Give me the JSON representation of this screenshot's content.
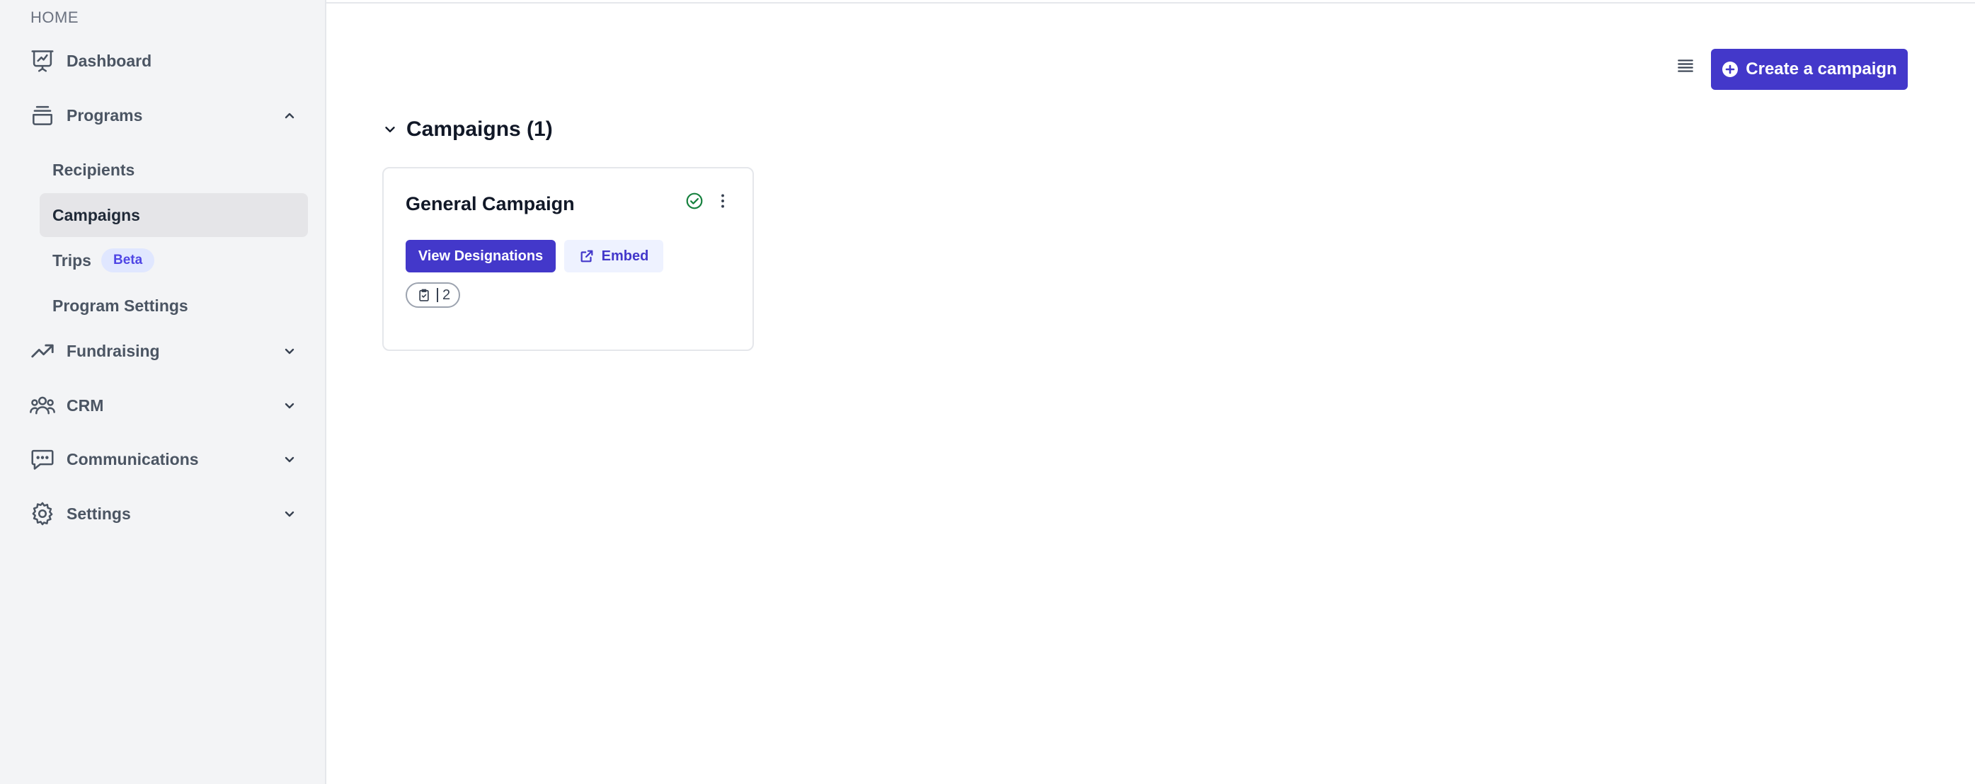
{
  "sidebar": {
    "section_label": "HOME",
    "items": [
      {
        "label": "Dashboard",
        "icon": "presentation-chart-icon"
      },
      {
        "label": "Programs",
        "icon": "inbox-stack-icon",
        "expanded": true
      },
      {
        "label": "Fundraising",
        "icon": "trending-up-icon",
        "expanded": false
      },
      {
        "label": "CRM",
        "icon": "user-group-icon",
        "expanded": false
      },
      {
        "label": "Communications",
        "icon": "chat-bubble-icon",
        "expanded": false
      },
      {
        "label": "Settings",
        "icon": "gear-icon",
        "expanded": false
      }
    ],
    "program_subitems": [
      {
        "label": "Recipients"
      },
      {
        "label": "Campaigns",
        "active": true
      },
      {
        "label": "Trips",
        "badge": "Beta"
      },
      {
        "label": "Program Settings"
      }
    ]
  },
  "toolbar": {
    "create_label": "Create a campaign",
    "list_view_icon": "list-view-icon"
  },
  "campaigns": {
    "section_title": "Campaigns (1)",
    "cards": [
      {
        "title": "General Campaign",
        "status_icon": "check-circle-icon",
        "view_label": "View Designations",
        "embed_label": "Embed",
        "designation_count": "2"
      }
    ]
  },
  "colors": {
    "primary": "#4338ca",
    "sidebar_bg": "#f3f4f6",
    "active_item_bg": "#e5e5e8",
    "success": "#15803d"
  }
}
